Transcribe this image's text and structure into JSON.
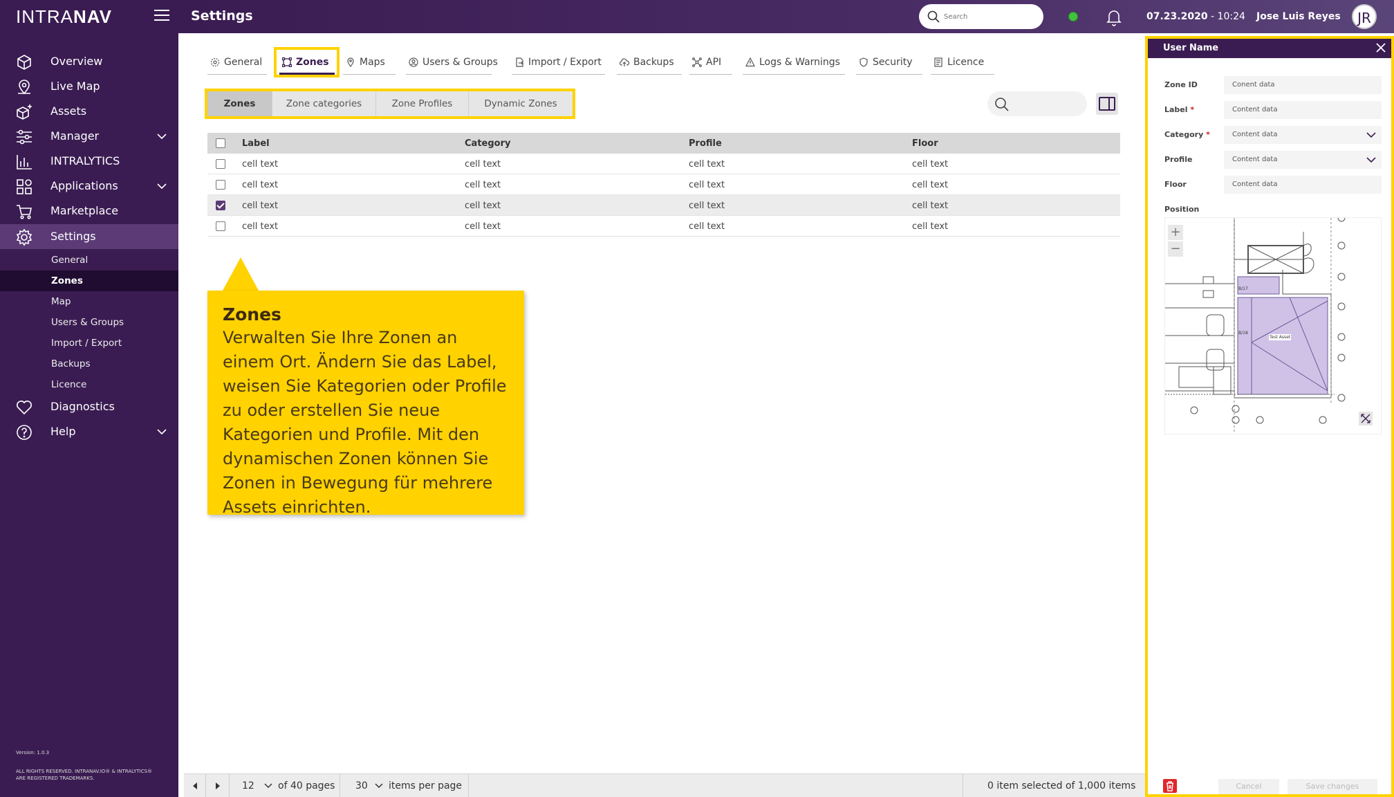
{
  "brand": {
    "logo_light": "INTRA",
    "logo_bold": "NAV"
  },
  "sidebar": {
    "items": [
      {
        "label": "Overview",
        "icon": "cube-icon"
      },
      {
        "label": "Live Map",
        "icon": "map-pin-icon"
      },
      {
        "label": "Assets",
        "icon": "asset-plus-icon"
      },
      {
        "label": "Manager",
        "icon": "sliders-icon"
      },
      {
        "label": "INTRALYTICS",
        "icon": "bar-chart-icon"
      },
      {
        "label": "Applications",
        "icon": "apps-icon"
      },
      {
        "label": "Marketplace",
        "icon": "cart-icon"
      },
      {
        "label": "Settings",
        "icon": "gear-icon"
      },
      {
        "label": "Diagnostics",
        "icon": "heart-icon"
      },
      {
        "label": "Help",
        "icon": "help-circle-icon"
      }
    ],
    "sub_items": [
      "General",
      "Zones",
      "Map",
      "Users & Groups",
      "Import / Export",
      "Backups",
      "Licence"
    ],
    "version": "Version: 1.0.3",
    "rights_line1": "ALL RIGHTS RESERVED. INTRANAV.IO® & INTRALYTICS®",
    "rights_line2": "ARE REGISTERED TRADEMARKS."
  },
  "topbar": {
    "title": "Settings",
    "search_placeholder": "Search",
    "date": "07.23.2020",
    "time": "10:24",
    "user": "Jose Luis Reyes",
    "avatar_initials": "JR",
    "status_color": "#3fc33c"
  },
  "tabs": [
    "General",
    "Zones",
    "Maps",
    "Users & Groups",
    "Import / Export",
    "Backups",
    "API",
    "Logs & Warnings",
    "Security",
    "Licence"
  ],
  "subtabs": [
    "Zones",
    "Zone categories",
    "Zone Profiles",
    "Dynamic Zones"
  ],
  "table": {
    "columns": [
      "Label",
      "Category",
      "Profile",
      "Floor"
    ],
    "rows": [
      {
        "label": "cell text",
        "category": "cell text",
        "profile": "cell text",
        "floor": "cell text",
        "checked": false
      },
      {
        "label": "cell text",
        "category": "cell text",
        "profile": "cell text",
        "floor": "cell text",
        "checked": false
      },
      {
        "label": "cell text",
        "category": "cell text",
        "profile": "cell text",
        "floor": "cell text",
        "checked": true
      },
      {
        "label": "cell text",
        "category": "cell text",
        "profile": "cell text",
        "floor": "cell text",
        "checked": false
      }
    ]
  },
  "callout": {
    "title": "Zones",
    "body": "Verwalten Sie Ihre Zonen an einem Ort. Ändern Sie das Label, weisen Sie Kategorien oder Profile zu oder erstellen Sie neue Kategorien und Profile. Mit den dynamischen Zonen können Sie Zonen in Bewegung für mehrere Assets einrichten."
  },
  "footer": {
    "page": "12",
    "of_pages": "of 40 pages",
    "per_page": "30",
    "per_page_label": "items per page",
    "selection": "0 item selected of 1,000 items"
  },
  "panel": {
    "title": "User Name",
    "fields": [
      {
        "label": "Zone ID",
        "value": "Conent data",
        "required": false
      },
      {
        "label": "Label",
        "value": "Content data",
        "required": true
      },
      {
        "label": "Category",
        "value": "Content data",
        "required": true
      },
      {
        "label": "Profile",
        "value": "Content data",
        "required": false
      },
      {
        "label": "Floor",
        "value": "Content data",
        "required": false
      }
    ],
    "position_label": "Position",
    "zoom_in": "+",
    "zoom_out": "−",
    "map_room_labels": [
      "B/17",
      "B/18",
      "Test Asset"
    ],
    "cancel_label": "Cancel",
    "save_label": "Save changes"
  },
  "colors": {
    "accent": "#3a1c52",
    "highlight": "#ffd200",
    "danger": "#e0262c"
  }
}
